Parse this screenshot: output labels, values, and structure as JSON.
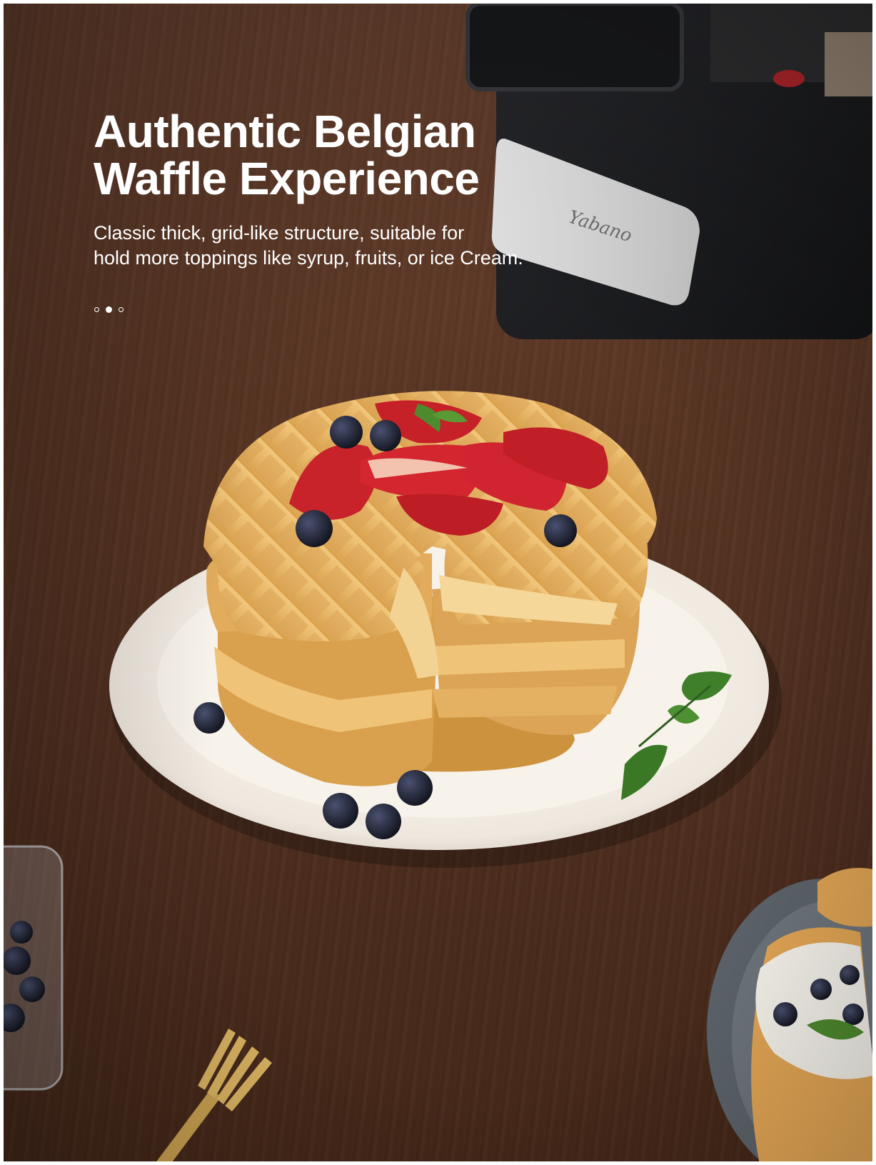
{
  "headline": {
    "line1": "Authentic Belgian",
    "line2": "Waffle Experience"
  },
  "subtitle": {
    "line1": "Classic thick, grid-like structure, suitable for",
    "line2": "hold more toppings like syrup, fruits, or ice Cream."
  },
  "carousel": {
    "active_index": 1,
    "count": 3
  },
  "brand": {
    "logo_text": "Yabano"
  },
  "colors": {
    "wood": "#5a3624",
    "text": "#ffffff",
    "waffle": "#e9b96a",
    "plate": "#f4efe8",
    "strawberry": "#c8222b",
    "blueberry": "#1f2233",
    "syrup": "#c98a2e",
    "machine": "#1c1d20"
  },
  "image": {
    "subject": "waffle-stack-photo"
  }
}
